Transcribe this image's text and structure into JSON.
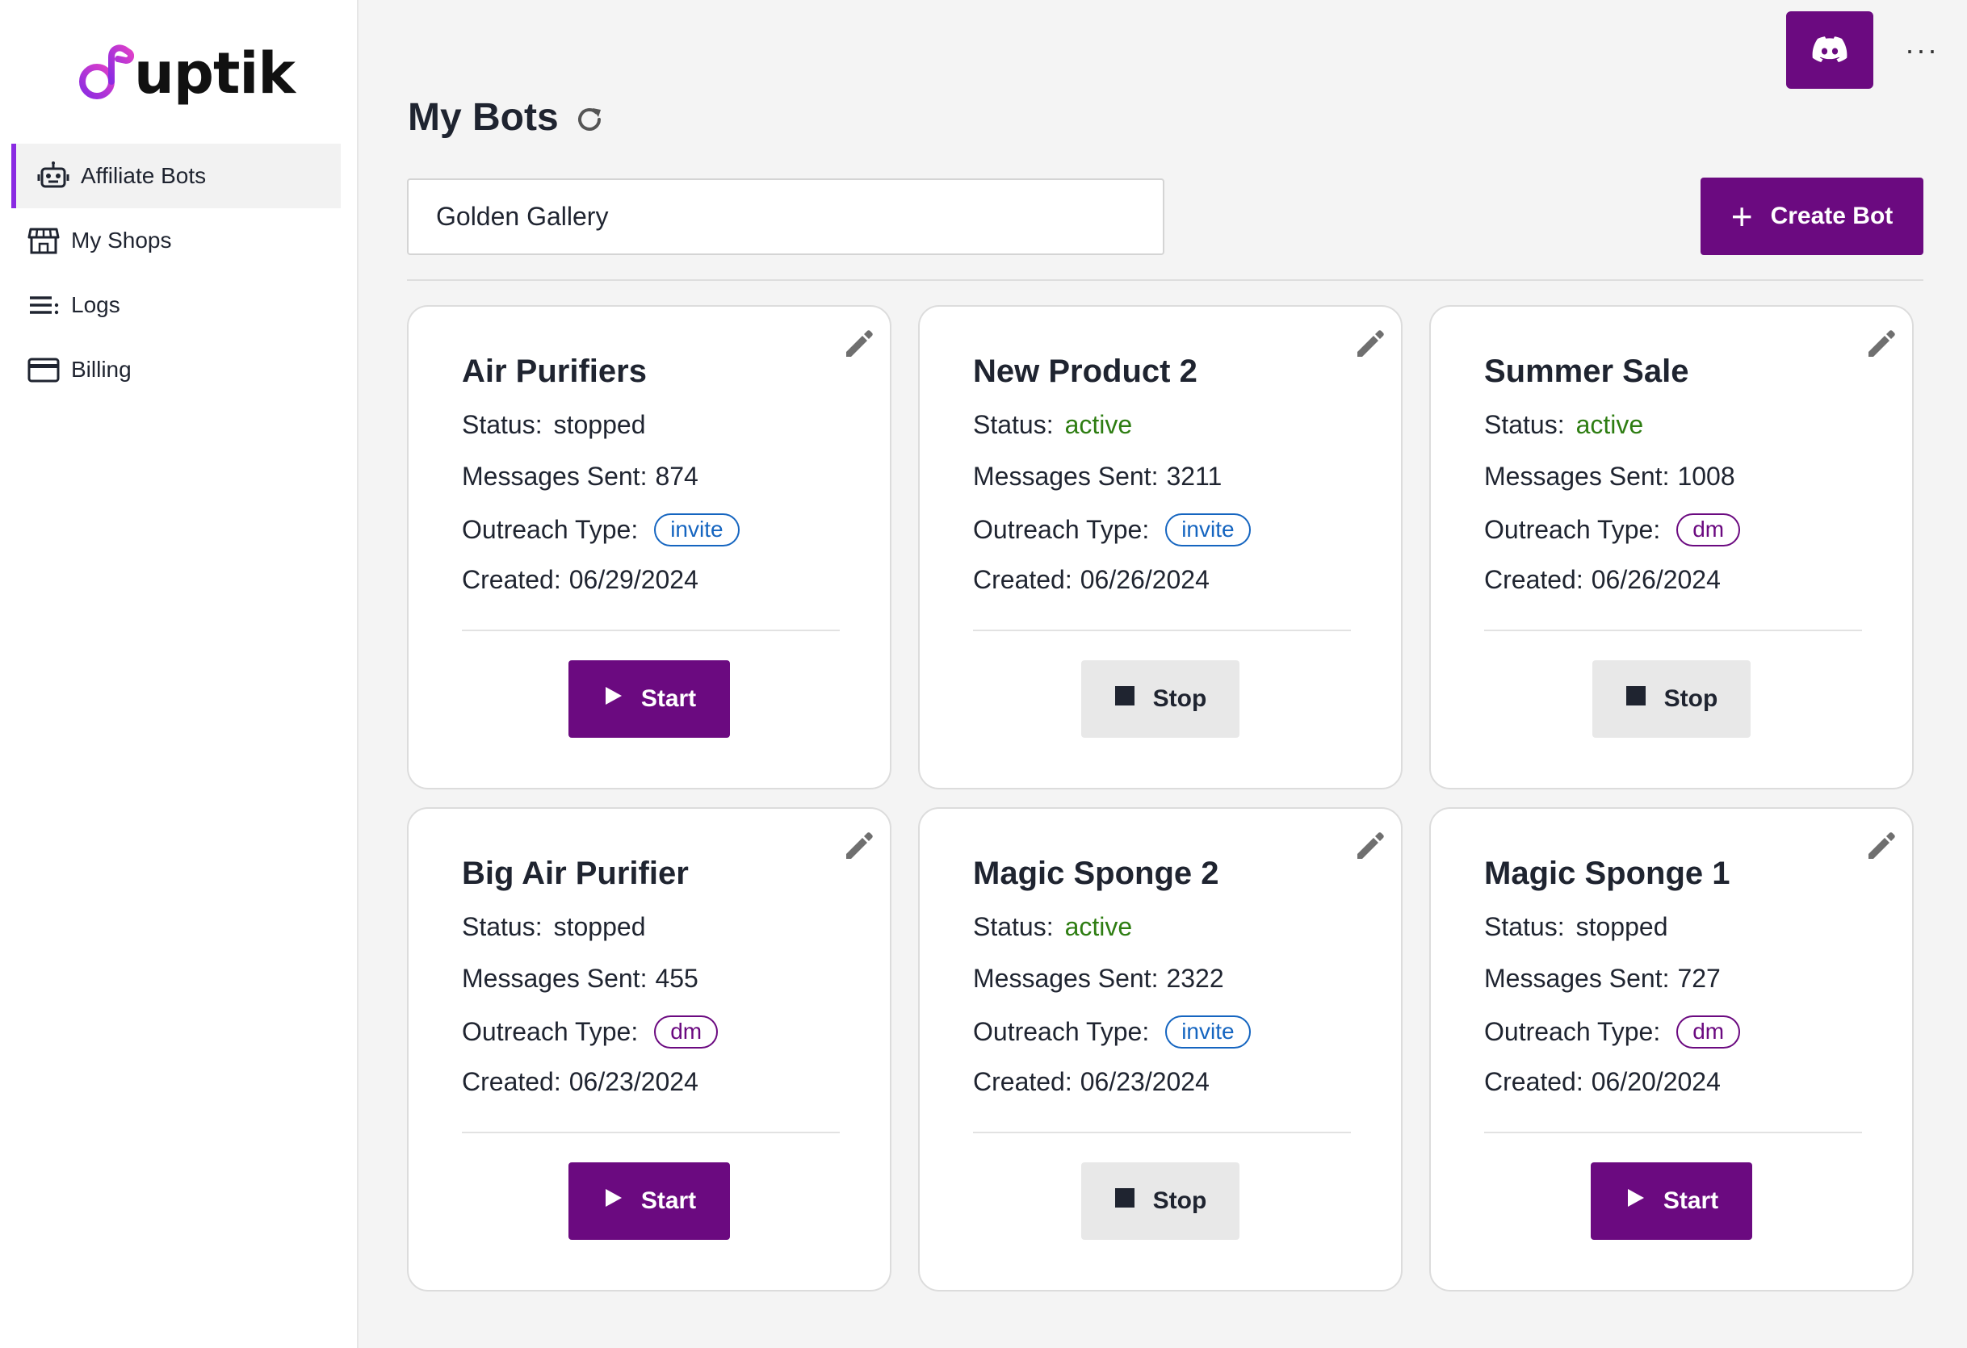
{
  "brand": {
    "name": "uptik",
    "accent": "#6b0a80",
    "highlight": "#8a2be2"
  },
  "sidebar": {
    "items": [
      {
        "label": "Affiliate Bots",
        "icon": "robot-icon",
        "active": true
      },
      {
        "label": "My Shops",
        "icon": "storefront-icon",
        "active": false
      },
      {
        "label": "Logs",
        "icon": "list-icon",
        "active": false
      },
      {
        "label": "Billing",
        "icon": "credit-card-icon",
        "active": false
      }
    ]
  },
  "header": {
    "title": "My Bots",
    "search_value": "Golden Gallery",
    "create_label": "Create Bot",
    "more_label": "···"
  },
  "labels": {
    "status": "Status:",
    "messages": "Messages Sent:",
    "outreach": "Outreach Type:",
    "created": "Created:"
  },
  "bots": [
    {
      "name": "Air Purifiers",
      "status": "stopped",
      "messages": "874",
      "outreach": "invite",
      "created": "06/29/2024",
      "action": "Start"
    },
    {
      "name": "New Product 2",
      "status": "active",
      "messages": "3211",
      "outreach": "invite",
      "created": "06/26/2024",
      "action": "Stop"
    },
    {
      "name": "Summer Sale",
      "status": "active",
      "messages": "1008",
      "outreach": "dm",
      "created": "06/26/2024",
      "action": "Stop"
    },
    {
      "name": "Big Air Purifier",
      "status": "stopped",
      "messages": "455",
      "outreach": "dm",
      "created": "06/23/2024",
      "action": "Start"
    },
    {
      "name": "Magic Sponge 2",
      "status": "active",
      "messages": "2322",
      "outreach": "invite",
      "created": "06/23/2024",
      "action": "Stop"
    },
    {
      "name": "Magic Sponge 1",
      "status": "stopped",
      "messages": "727",
      "outreach": "dm",
      "created": "06/20/2024",
      "action": "Start"
    }
  ]
}
